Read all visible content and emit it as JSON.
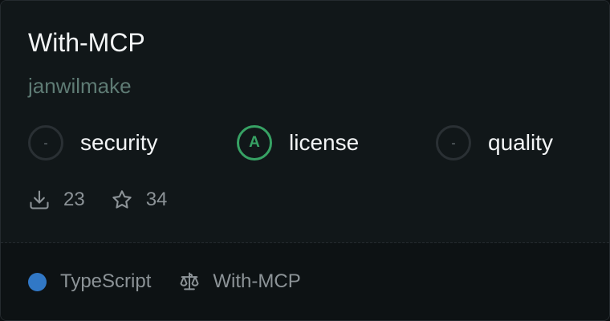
{
  "card": {
    "title": "With-MCP",
    "author": "janwilmake"
  },
  "scores": [
    {
      "grade": "-",
      "label": "security",
      "status": "none"
    },
    {
      "grade": "A",
      "label": "license",
      "status": "pass"
    },
    {
      "grade": "-",
      "label": "quality",
      "status": "none"
    }
  ],
  "stats": {
    "downloads": "23",
    "stars": "34",
    "download_icon": "download-icon",
    "star_icon": "star-icon"
  },
  "footer": {
    "language": "TypeScript",
    "language_color": "#3178c6",
    "license": "With-MCP",
    "license_icon": "scale-icon"
  },
  "colors": {
    "grade_pass": "#37a264",
    "author": "#5e7b74"
  }
}
